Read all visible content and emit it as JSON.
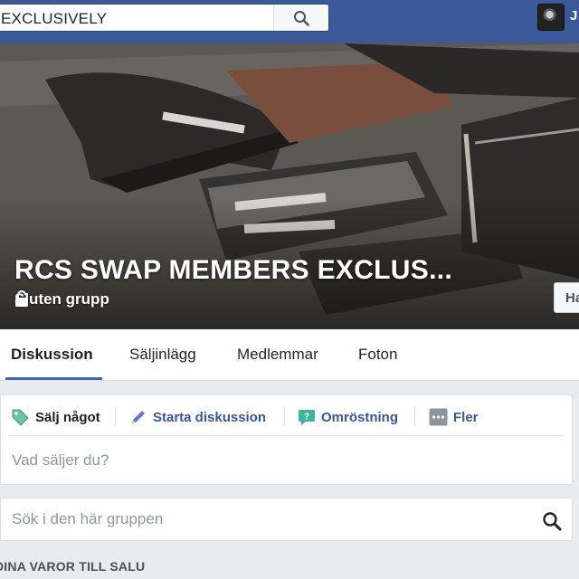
{
  "topbar": {
    "search_value": "EXCLUSIVELY",
    "user_initial": "J"
  },
  "cover": {
    "group_name": "RCS SWAP MEMBERS EXCLUS...",
    "privacy": "Sluten grupp",
    "join_button": "Ha"
  },
  "tabs": [
    {
      "label": "Diskussion",
      "active": true
    },
    {
      "label": "Säljinlägg",
      "active": false
    },
    {
      "label": "Medlemmar",
      "active": false
    },
    {
      "label": "Foton",
      "active": false
    }
  ],
  "composer": {
    "actions": [
      {
        "label": "Sälj något",
        "icon": "price-tag-icon"
      },
      {
        "label": "Starta diskussion",
        "icon": "pencil-icon"
      },
      {
        "label": "Omröstning",
        "icon": "poll-icon"
      },
      {
        "label": "Fler",
        "icon": "more-icon"
      }
    ],
    "prompt": "Vad säljer du?"
  },
  "group_search": {
    "placeholder": "Sök i den här gruppen"
  },
  "section": {
    "heading": "DINA VAROR TILL SALU"
  },
  "colors": {
    "brand": "#3b5998",
    "tab_accent": "#4267b2",
    "link": "#365899"
  }
}
